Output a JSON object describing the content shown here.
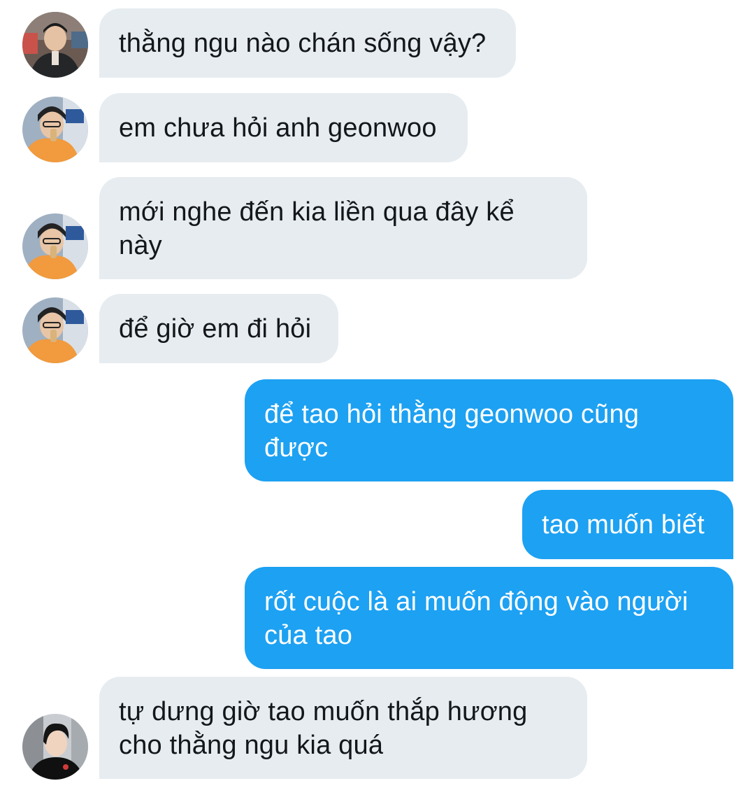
{
  "thread": {
    "messages": [
      {
        "id": "m1",
        "side": "incoming",
        "avatar": "avatar-icon-user-1",
        "lines": [
          "thằng ngu nào chán sống vậy?"
        ]
      },
      {
        "id": "m2",
        "side": "incoming",
        "avatar": "avatar-icon-user-2",
        "lines": [
          "em chưa hỏi anh geonwoo"
        ]
      },
      {
        "id": "m3",
        "side": "incoming",
        "avatar": "avatar-icon-user-2",
        "lines": [
          "mới nghe đến kia liền qua đây kể",
          "này"
        ]
      },
      {
        "id": "m4",
        "side": "incoming",
        "avatar": "avatar-icon-user-2",
        "lines": [
          "để giờ em đi hỏi"
        ]
      },
      {
        "id": "m5",
        "side": "outgoing",
        "lines": [
          "để tao hỏi thằng geonwoo cũng",
          "được"
        ]
      },
      {
        "id": "m6",
        "side": "outgoing",
        "lines": [
          "tao muốn biết"
        ]
      },
      {
        "id": "m7",
        "side": "outgoing",
        "lines": [
          "rốt cuộc là ai muốn động vào người",
          "của tao"
        ]
      },
      {
        "id": "m8",
        "side": "incoming",
        "avatar": "avatar-icon-user-3",
        "lines": [
          "tự dưng giờ tao muốn thắp hương",
          "cho thằng ngu kia quá"
        ]
      }
    ]
  },
  "colors": {
    "incoming_bubble": "#e6ecf0",
    "outgoing_bubble": "#1da1f2",
    "incoming_text": "#14171a",
    "outgoing_text": "#ffffff"
  }
}
